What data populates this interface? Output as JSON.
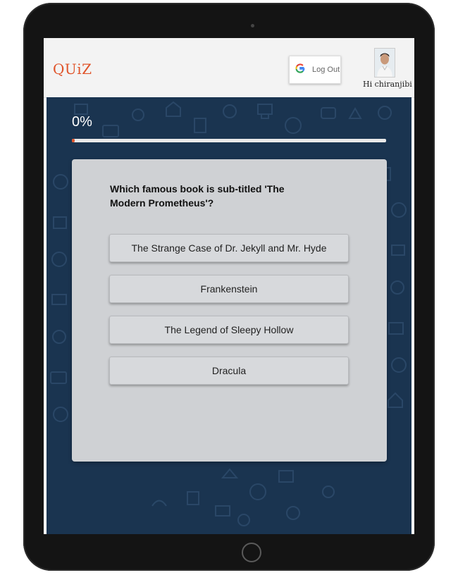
{
  "header": {
    "logo": "QUiZ",
    "logout_label": "Log Out",
    "greeting": "Hi chiranjibi"
  },
  "progress": {
    "label": "0%",
    "fraction": 0
  },
  "question": {
    "text": "Which famous book is sub-titled 'The Modern Prometheus'?",
    "options": [
      "The Strange Case of Dr. Jekyll and Mr. Hyde",
      "Frankenstein",
      "The Legend of Sleepy Hollow",
      "Dracula"
    ]
  },
  "colors": {
    "accent": "#e0542a",
    "background": "#1a3450",
    "card": "#cfd1d4"
  },
  "icons": [
    "google-icon",
    "avatar-photo"
  ]
}
